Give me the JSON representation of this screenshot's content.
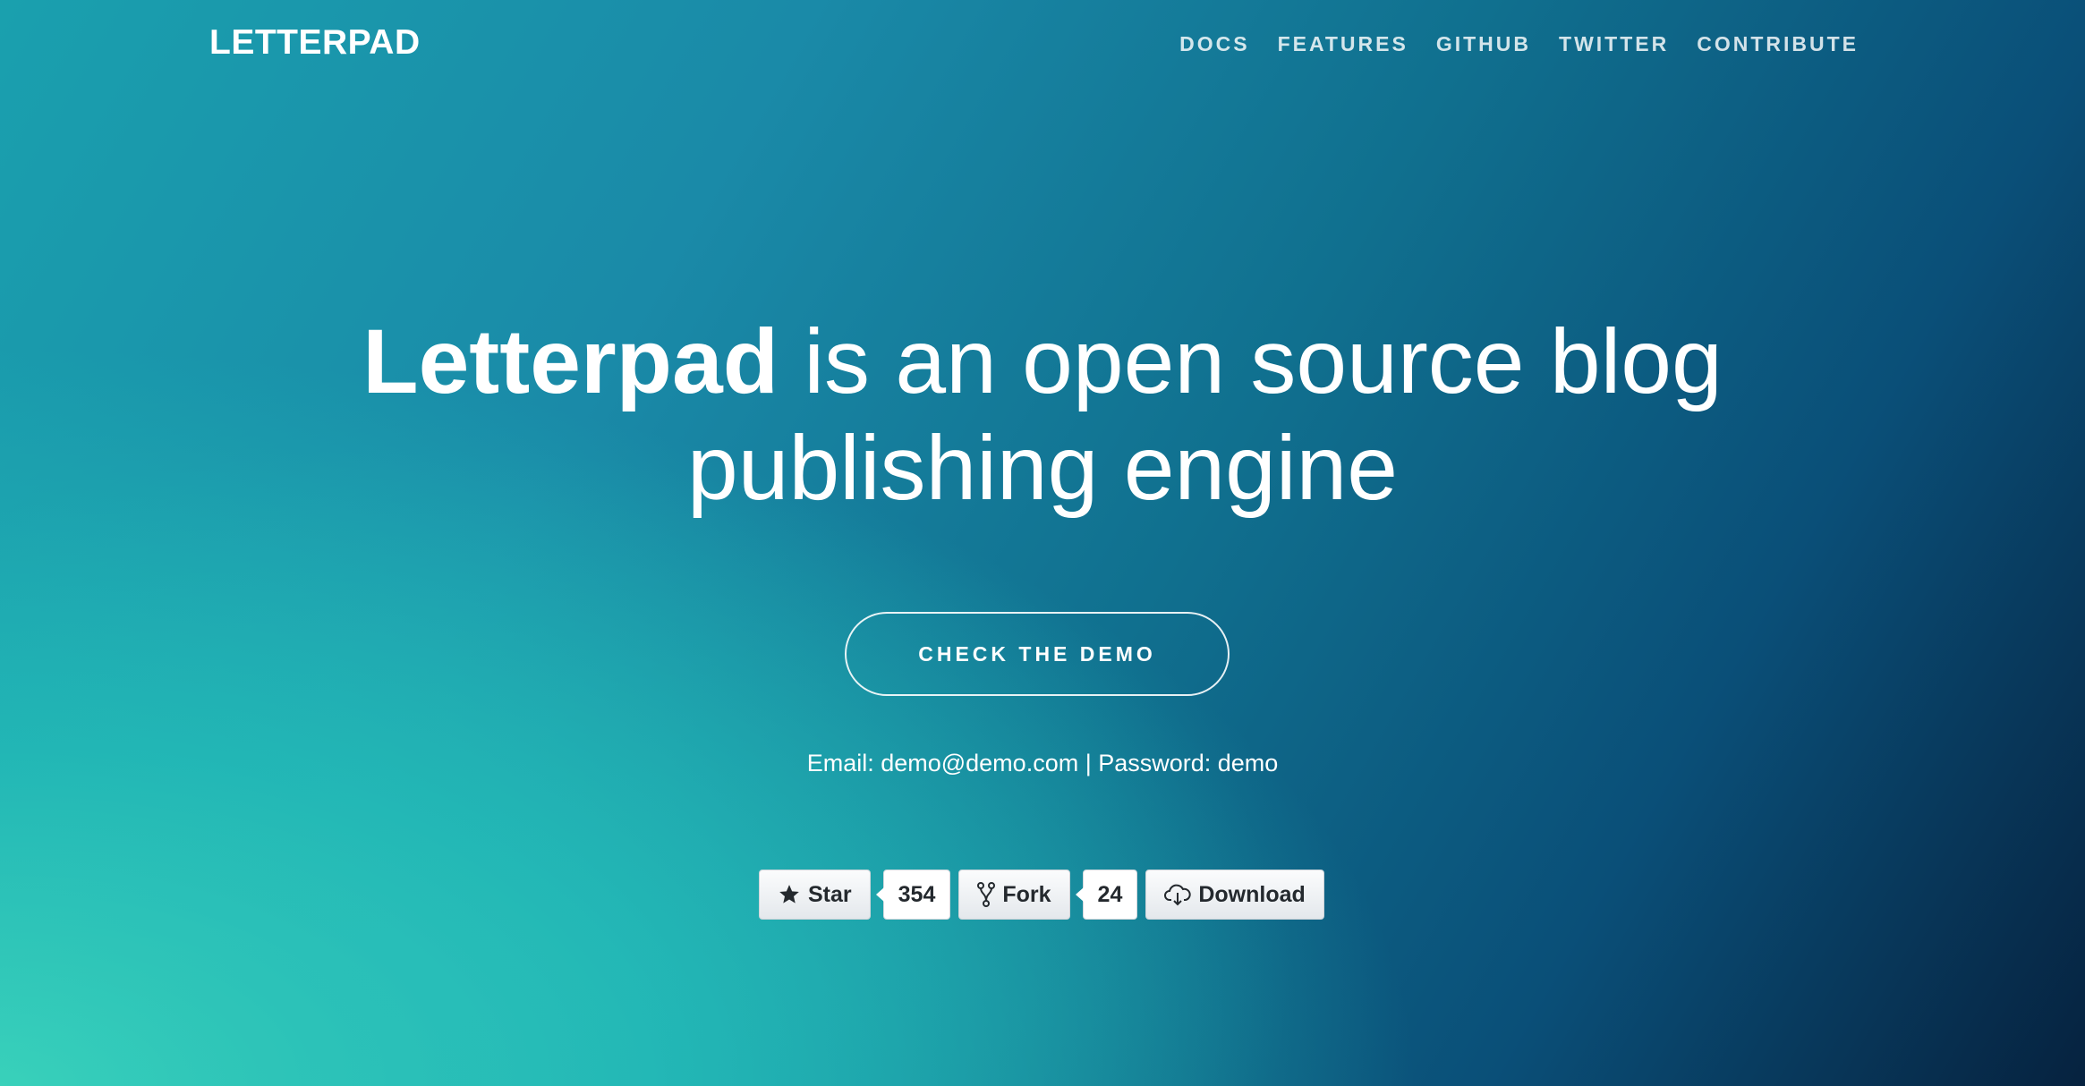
{
  "header": {
    "logo": "LETTERPAD",
    "nav": [
      "DOCS",
      "FEATURES",
      "GITHUB",
      "TWITTER",
      "CONTRIBUTE"
    ]
  },
  "hero": {
    "title_brand": "Letterpad",
    "title_rest_line1": " is an open source blog",
    "title_line2": "publishing engine",
    "cta_label": "CHECK THE DEMO",
    "credentials": "Email: demo@demo.com | Password: demo"
  },
  "github": {
    "star_label": "Star",
    "star_count": "354",
    "fork_label": "Fork",
    "fork_count": "24",
    "download_label": "Download"
  },
  "icons": {
    "star": "star-icon",
    "fork": "fork-icon",
    "download": "cloud-download-icon"
  },
  "colors": {
    "text": "#ffffff",
    "button_text": "#24292e",
    "gradient_start": "#3fd8bb",
    "gradient_end": "#06223f"
  }
}
